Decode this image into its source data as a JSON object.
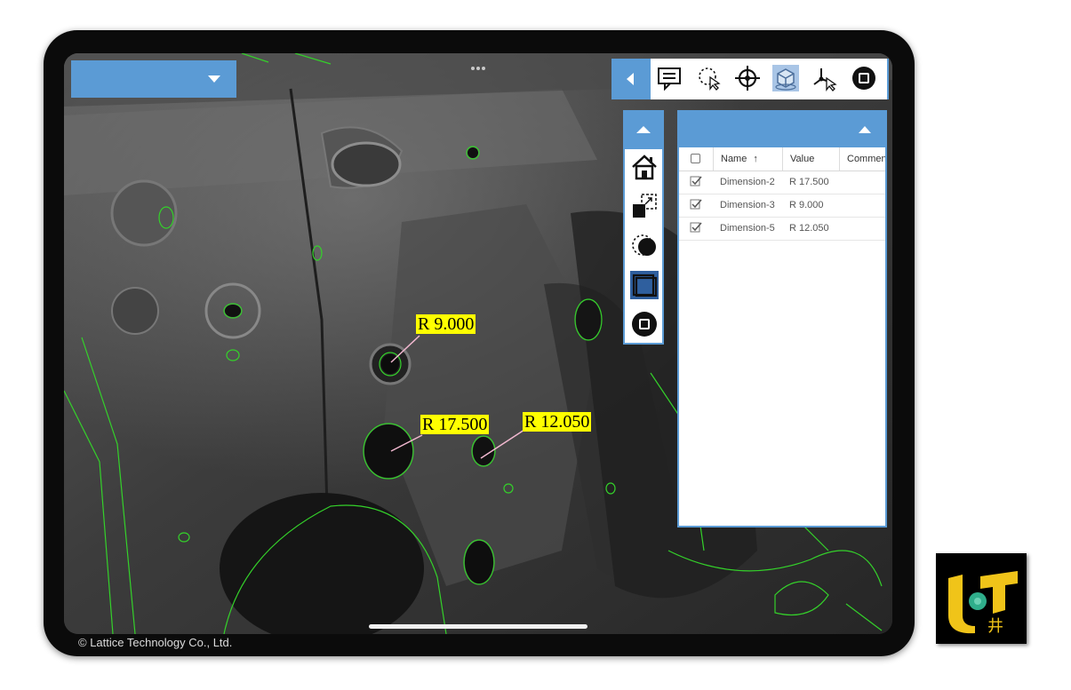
{
  "copyright": "© Lattice Technology Co., Ltd.",
  "colors": {
    "accent": "#5b9bd5",
    "label_bg": "#ffff00",
    "edge_lines": "#34d12a",
    "active_tool": "#2f5f9e"
  },
  "toolbar": {
    "icons": [
      "comment-icon",
      "lasso-select-icon",
      "crosshair-icon",
      "3d-box-icon",
      "axis-select-icon",
      "stop-icon"
    ]
  },
  "sidebar": {
    "icons": [
      "home-icon",
      "fit-view-icon",
      "hide-toggle-icon",
      "window-icon",
      "stop-icon"
    ]
  },
  "table": {
    "columns": [
      "Name",
      "Value",
      "Comment"
    ],
    "sort_indicator": "↑",
    "rows": [
      {
        "name": "Dimension-2",
        "value": "R 17.500",
        "checked": true
      },
      {
        "name": "Dimension-3",
        "value": "R 9.000",
        "checked": true
      },
      {
        "name": "Dimension-5",
        "value": "R 12.050",
        "checked": true
      }
    ]
  },
  "annotations": [
    {
      "label": "R 9.000"
    },
    {
      "label": "R 17.500"
    },
    {
      "label": "R 12.050"
    }
  ],
  "logo": {
    "glyph": "井"
  }
}
